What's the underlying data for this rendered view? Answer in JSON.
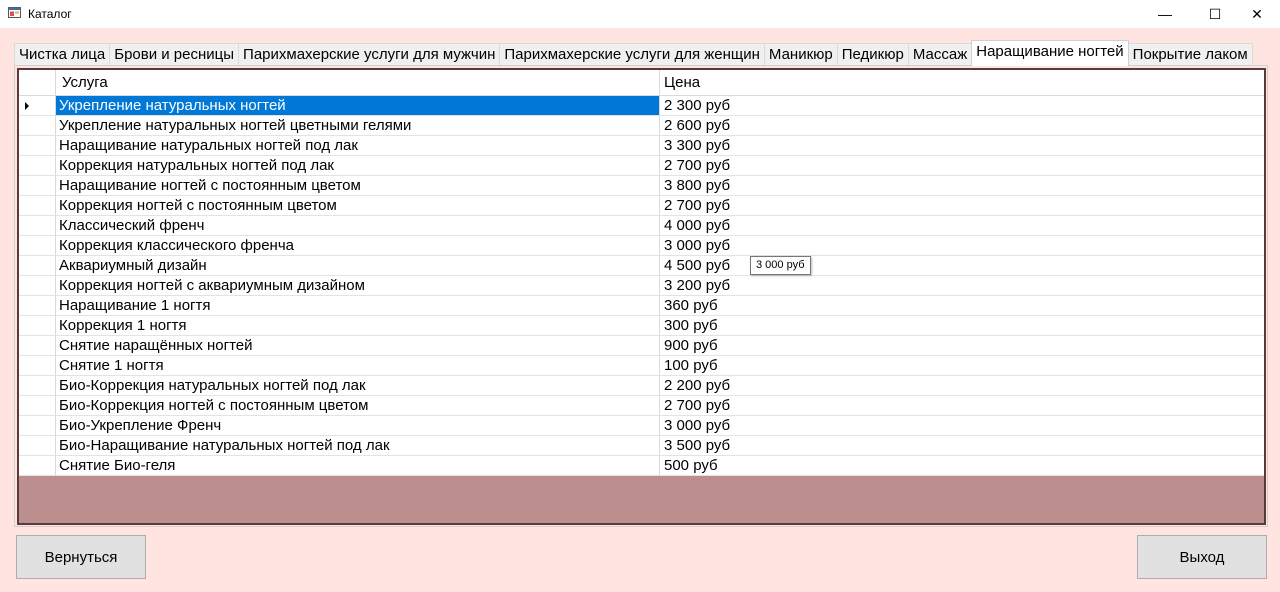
{
  "window": {
    "title": "Каталог",
    "minimize_glyph": "—",
    "maximize_glyph": "☐",
    "close_glyph": "✕",
    "icon": "window-icon"
  },
  "tabs": [
    {
      "label": "Чистка лица",
      "active": false
    },
    {
      "label": "Брови и ресницы",
      "active": false
    },
    {
      "label": "Парихмахерские услуги для мужчин",
      "active": false
    },
    {
      "label": "Парихмахерские услуги для женщин",
      "active": false
    },
    {
      "label": "Маникюр",
      "active": false
    },
    {
      "label": "Педикюр",
      "active": false
    },
    {
      "label": "Массаж",
      "active": false
    },
    {
      "label": "Наращивание ногтей",
      "active": true
    },
    {
      "label": "Покрытие лаком",
      "active": false
    }
  ],
  "grid": {
    "columns": [
      "Услуга",
      "Цена"
    ],
    "rows": [
      [
        "Укрепление натуральных ногтей",
        "2 300 руб"
      ],
      [
        "Укрепление натуральных ногтей цветными гелями",
        "2 600 руб"
      ],
      [
        "Наращивание натуральных ногтей под лак",
        "3 300 руб"
      ],
      [
        "Коррекция натуральных ногтей под лак",
        "2 700 руб"
      ],
      [
        "Наращивание ногтей с постоянным цветом",
        "3 800 руб"
      ],
      [
        "Коррекция ногтей с постоянным цветом",
        "2 700 руб"
      ],
      [
        "Классический френч",
        "4 000 руб"
      ],
      [
        "Коррекция классического френча",
        "3 000 руб"
      ],
      [
        "Аквариумный дизайн",
        "4 500 руб"
      ],
      [
        "Коррекция ногтей с аквариумным дизайном",
        "3 200 руб"
      ],
      [
        "Наращивание 1 ногтя",
        "360 руб"
      ],
      [
        "Коррекция 1 ногтя",
        "300 руб"
      ],
      [
        "Снятие наращённых ногтей",
        "900 руб"
      ],
      [
        "Снятие 1 ногтя",
        "100 руб"
      ],
      [
        "Био-Коррекция натуральных ногтей под лак",
        "2 200 руб"
      ],
      [
        "Био-Коррекция ногтей с постоянным цветом",
        "2 700 руб"
      ],
      [
        "Био-Укрепление Френч",
        "3 000 руб"
      ],
      [
        "Био-Наращивание натуральных ногтей под лак",
        "3 500 руб"
      ],
      [
        "Снятие Био-геля",
        "500 руб"
      ]
    ],
    "selected_row": 0
  },
  "tooltip": "3 000 руб",
  "buttons": {
    "back": "Вернуться",
    "exit": "Выход"
  },
  "colors": {
    "form_background": "#ffe4e1",
    "grid_background": "#bc8f8f",
    "selection": "#0078d7",
    "grid_border": "#5a3a3a"
  }
}
